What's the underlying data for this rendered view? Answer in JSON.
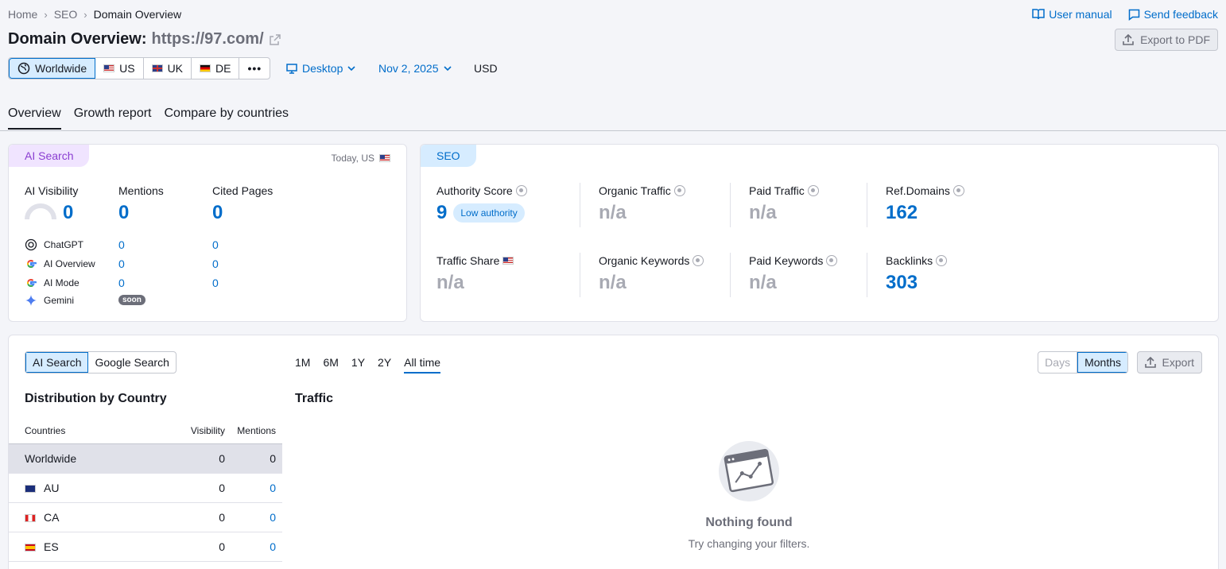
{
  "breadcrumb": [
    "Home",
    "SEO",
    "Domain Overview"
  ],
  "header": {
    "user_manual": "User manual",
    "send_feedback": "Send feedback",
    "title_prefix": "Domain Overview:",
    "domain": "https://97.com/",
    "export_pdf": "Export to PDF"
  },
  "databases": [
    "Worldwide",
    "US",
    "UK",
    "DE"
  ],
  "more_icon": "more-dots-icon",
  "device": "Desktop",
  "date": "Nov 2, 2025",
  "currency": "USD",
  "tabs": [
    "Overview",
    "Growth report",
    "Compare by countries"
  ],
  "ai_card": {
    "pill": "AI Search",
    "date_label": "Today, US",
    "metrics": [
      {
        "label": "AI Visibility",
        "value": "0"
      },
      {
        "label": "Mentions",
        "value": "0"
      },
      {
        "label": "Cited Pages",
        "value": "0"
      }
    ],
    "sources": [
      {
        "name": "ChatGPT",
        "mentions": "0",
        "cited": "0",
        "icon": "chatgpt-icon"
      },
      {
        "name": "AI Overview",
        "mentions": "0",
        "cited": "0",
        "icon": "google-icon"
      },
      {
        "name": "AI Mode",
        "mentions": "0",
        "cited": "0",
        "icon": "google-icon"
      },
      {
        "name": "Gemini",
        "badge": "soon",
        "icon": "gemini-icon"
      }
    ]
  },
  "seo_card": {
    "pill": "SEO",
    "authority_label": "Authority Score",
    "authority_value": "9",
    "authority_badge": "Low authority",
    "organic_traffic_label": "Organic Traffic",
    "organic_traffic_value": "n/a",
    "paid_traffic_label": "Paid Traffic",
    "paid_traffic_value": "n/a",
    "ref_domains_label": "Ref.Domains",
    "ref_domains_value": "162",
    "traffic_share_label": "Traffic Share",
    "traffic_share_value": "n/a",
    "organic_keywords_label": "Organic Keywords",
    "organic_keywords_value": "n/a",
    "paid_keywords_label": "Paid Keywords",
    "paid_keywords_value": "n/a",
    "backlinks_label": "Backlinks",
    "backlinks_value": "303"
  },
  "bottom": {
    "search_toggle": [
      "AI Search",
      "Google Search"
    ],
    "periods": [
      "1M",
      "6M",
      "1Y",
      "2Y",
      "All time"
    ],
    "granularity": [
      "Days",
      "Months"
    ],
    "export": "Export",
    "distribution_title": "Distribution by Country",
    "columns": [
      "Countries",
      "Visibility",
      "Mentions"
    ],
    "rows": [
      {
        "country": "Worldwide",
        "visibility": "0",
        "mentions": "0"
      },
      {
        "country": "AU",
        "visibility": "0",
        "mentions": "0"
      },
      {
        "country": "CA",
        "visibility": "0",
        "mentions": "0"
      },
      {
        "country": "ES",
        "visibility": "0",
        "mentions": "0"
      }
    ],
    "traffic_title": "Traffic",
    "empty_title": "Nothing found",
    "empty_sub": "Try changing your filters."
  }
}
